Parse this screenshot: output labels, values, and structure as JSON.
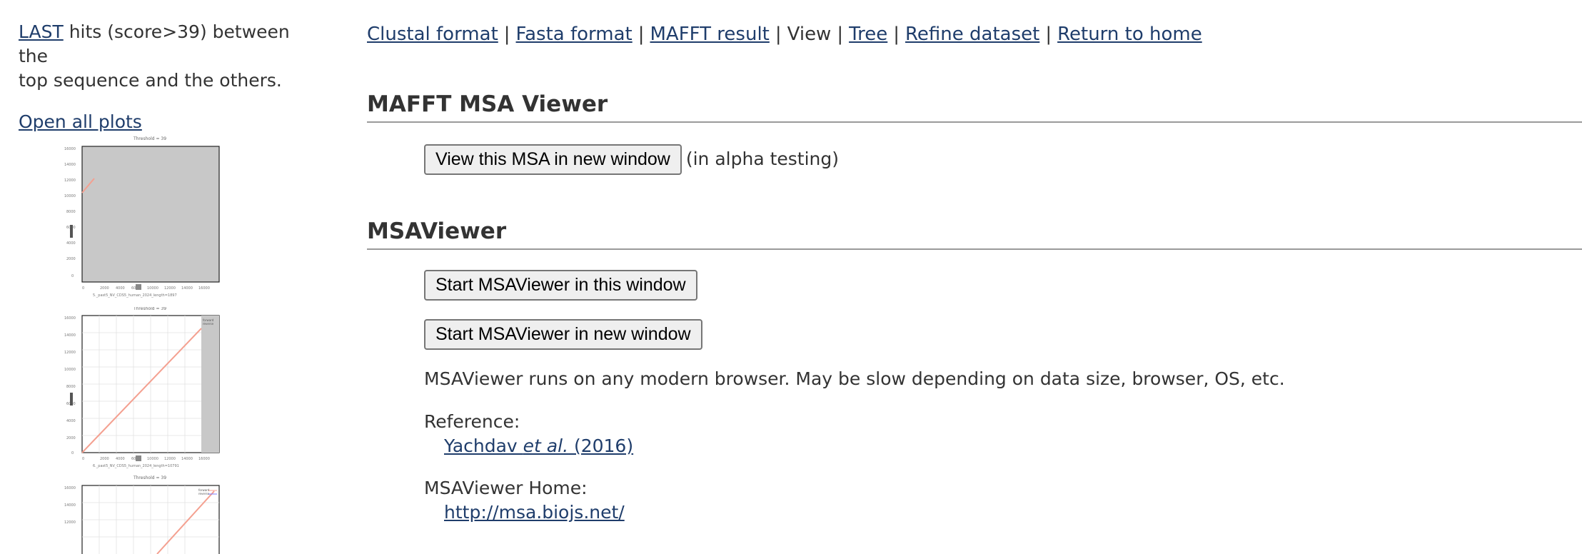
{
  "left": {
    "intro_link": "LAST",
    "intro_text_1": " hits (score>39) between the",
    "intro_text_2": "top sequence and the others.",
    "open_all_plots": "Open all plots"
  },
  "nav": {
    "items": [
      {
        "label": "Clustal format",
        "link": true
      },
      {
        "label": "Fasta format",
        "link": true
      },
      {
        "label": "MAFFT result",
        "link": true
      },
      {
        "label": "View",
        "link": false
      },
      {
        "label": "Tree",
        "link": true
      },
      {
        "label": "Refine dataset",
        "link": true
      },
      {
        "label": "Return to home",
        "link": true
      }
    ],
    "separator": "|"
  },
  "mafft_viewer": {
    "title": "MAFFT MSA Viewer",
    "button_label": "View this MSA in new window",
    "note": "(in alpha testing)"
  },
  "msaviewer": {
    "title": "MSAViewer",
    "button_this_window": "Start MSAViewer in this window",
    "button_new_window": "Start MSAViewer in new window",
    "description": "MSAViewer runs on any modern browser.  May be slow depending on data size, browser, OS, etc.",
    "reference_label": "Reference:",
    "reference_author": "Yachdav ",
    "reference_etal": "et al.",
    "reference_year": " (2016)",
    "home_label": "MSAViewer Home:",
    "home_url": "http://msa.biojs.net/"
  },
  "colors": {
    "link": "#1f3d6b",
    "text": "#333333",
    "plot_grey": "#c8c8c8",
    "plot_line": "#f4a090"
  }
}
